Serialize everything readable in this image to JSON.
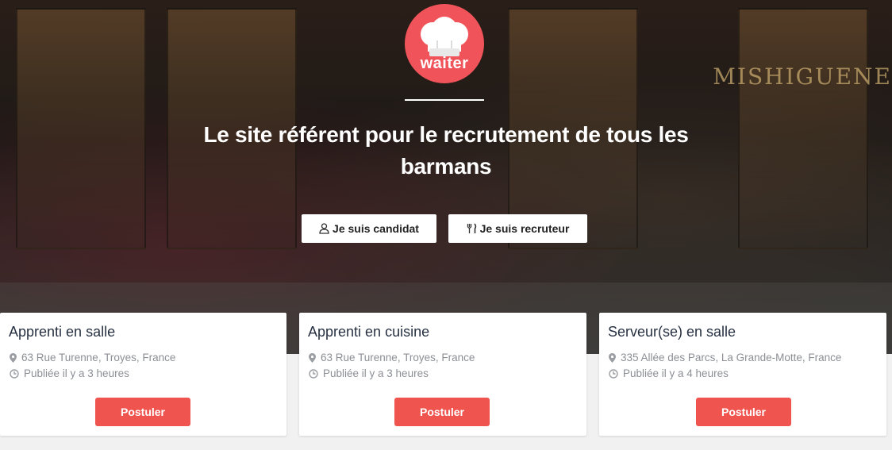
{
  "brand": {
    "logo_text": "waiter",
    "color": "#f0545a"
  },
  "hero": {
    "headline": "Le site référent pour le recrutement de tous les barmans",
    "background_sign_text": "MISHIGUENE",
    "buttons": [
      {
        "label": "Je suis candidat",
        "icon": "user-icon"
      },
      {
        "label": "Je suis recruteur",
        "icon": "cutlery-icon"
      }
    ]
  },
  "jobs": [
    {
      "title": "Apprenti en salle",
      "location": "63 Rue Turenne, Troyes, France",
      "published": "Publiée il y a 3 heures",
      "apply_label": "Postuler"
    },
    {
      "title": "Apprenti en cuisine",
      "location": "63 Rue Turenne, Troyes, France",
      "published": "Publiée il y a 3 heures",
      "apply_label": "Postuler"
    },
    {
      "title": "Serveur(se) en salle",
      "location": "335 Allée des Parcs, La Grande-Motte, France",
      "published": "Publiée il y a 4 heures",
      "apply_label": "Postuler"
    }
  ],
  "colors": {
    "accent": "#f0544f",
    "title_text": "#273142",
    "meta_text": "#8b8f95"
  }
}
